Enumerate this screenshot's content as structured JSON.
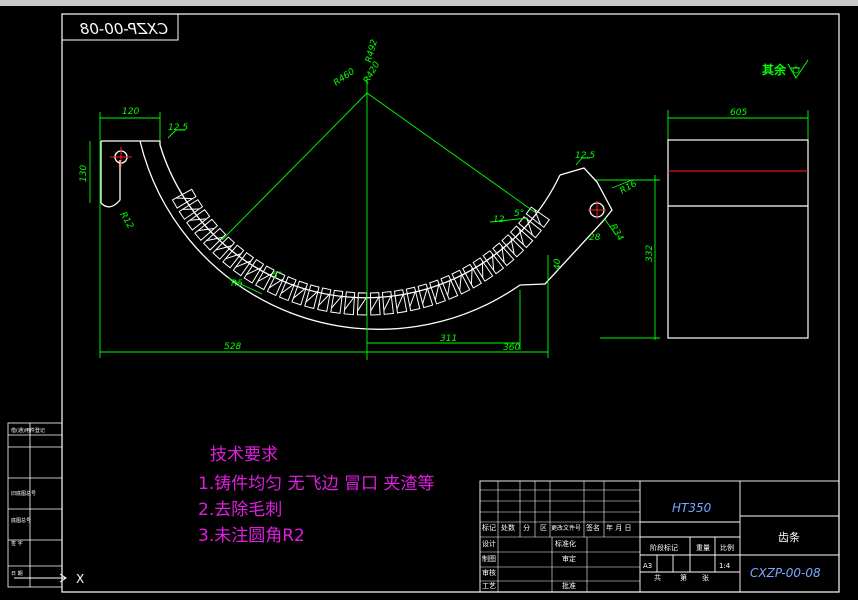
{
  "drawing_number": "CXZP-00-08",
  "drawing_number_mirrored": "CXZP-00-08",
  "surface_finish_note": "其余",
  "dimensions": {
    "radius_outer_a": "R492",
    "radius_outer_b": "R460",
    "radius_inner": "R420",
    "left_top_width": "120",
    "left_height": "130",
    "left_fillet": "R12",
    "bottom_left": "528",
    "bottom_mid": "311",
    "bottom_right": "360",
    "right_fillet": "R16",
    "right_hole": "R34",
    "ridge_height": "40",
    "side_width": "605",
    "side_height": "332",
    "rough_a": "12.5",
    "rough_b": "12.5",
    "tooth_angle": "5°",
    "tooth_step": "R5",
    "tooth_angle_b": "5°",
    "small_a": "12",
    "small_b": "28"
  },
  "tech_requirements": {
    "title": "技术要求",
    "items": [
      "1.铸件均匀 无飞边 冒口 夹渣等",
      "2.去除毛刺",
      "3.未注圆角R2"
    ]
  },
  "title_block": {
    "material": "HT350",
    "part_name": "齿条",
    "drawing_no": "CXZP-00-08",
    "labels": {
      "mark": "标记",
      "count": "处数",
      "zone": "分",
      "region": "区",
      "change_doc": "更改文件号",
      "signature": "签名",
      "date": "年 月 日",
      "design": "设计",
      "standardize": "标准化",
      "drawing": "制图",
      "review": "审定",
      "check": "审核",
      "process": "工艺",
      "approve": "批准",
      "stage_mark": "阶段标记",
      "weight": "重量",
      "scale": "比例",
      "sheets": "共",
      "sheet": "第",
      "zhang": "张",
      "size": "A3",
      "ratio": "1:4"
    }
  },
  "left_strip": [
    "借(通)用件登记",
    "旧底图总号",
    "底图总号",
    "签 字",
    "日 期"
  ],
  "colors": {
    "background": "#000000",
    "outline": "#ffffff",
    "dimension": "#00ff00",
    "center": "#ff2020",
    "note": "#e01ee0",
    "title_blue": "#7aa8ff"
  }
}
